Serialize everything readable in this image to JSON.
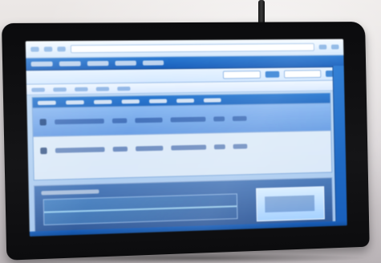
{
  "photo": {
    "subject": "",
    "colors": {
      "screen_blue": "#2f78c9",
      "screen_light": "#cfe3f6",
      "monitor_black": "#0b0b0d",
      "wall": "#ece8e6"
    }
  }
}
